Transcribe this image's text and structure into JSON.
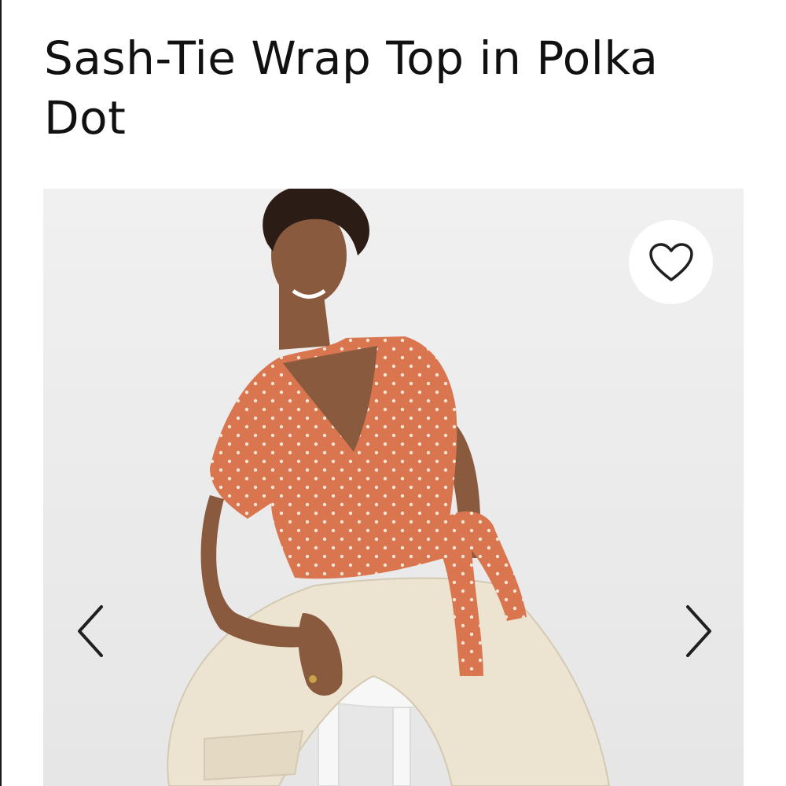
{
  "product": {
    "title": "Sash-Tie Wrap Top in Polka Dot"
  },
  "gallery": {
    "background_color": "#eeeeee",
    "favorite_icon": "heart-outline-icon",
    "prev_icon": "chevron-left-icon",
    "next_icon": "chevron-right-icon"
  },
  "colors": {
    "top": "#d9764f",
    "dots": "#f6e6d5",
    "pants": "#ece4d1",
    "skin": "#8a5a3e",
    "hair": "#2b1d15",
    "stool": "#f7f7f7",
    "icon_stroke": "#1f1f1f"
  }
}
